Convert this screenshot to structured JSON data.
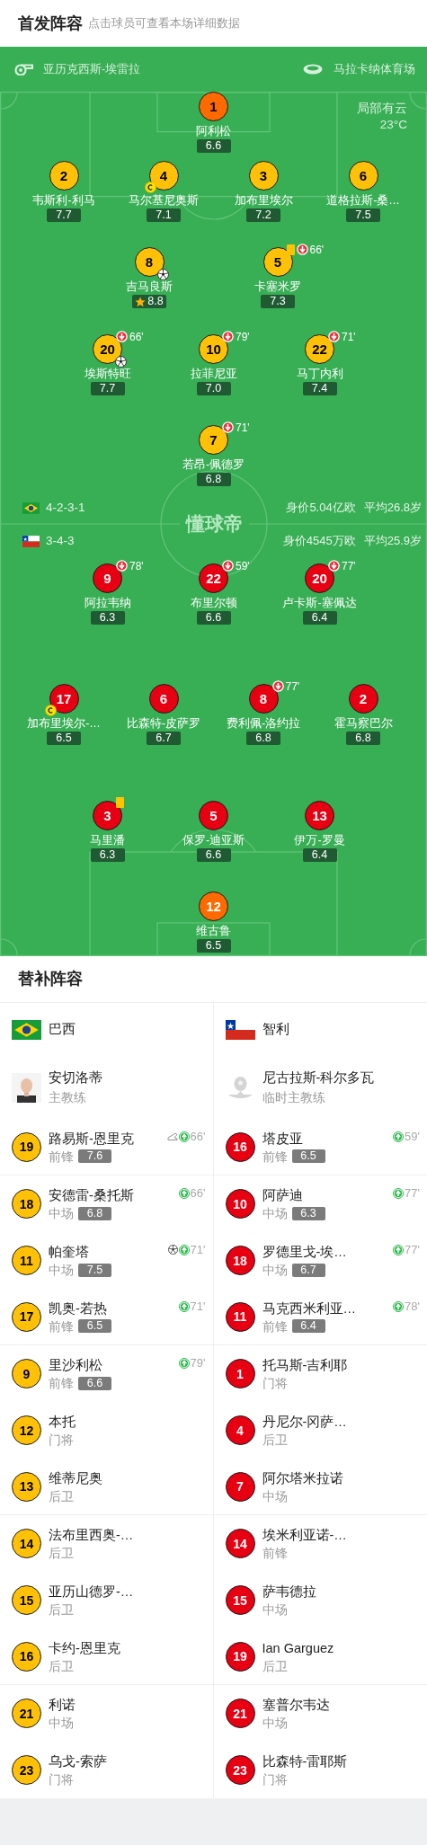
{
  "header": {
    "title": "首发阵容",
    "subtitle": "点击球员可查看本场详细数据"
  },
  "pitch": {
    "referee": "亚历克西斯-埃雷拉",
    "stadium": "马拉卡纳体育场",
    "weather": "局部有云",
    "temperature": "23°C",
    "center_logo": "懂球帝",
    "home": {
      "flag": {
        "kind": "brazil"
      },
      "color": "#ffc107",
      "number_style": {
        "color": "#000000"
      },
      "formation": "4-2-3-1",
      "value": "身价5.04亿欧",
      "avg_age": "平均26.8岁",
      "rows": [
        {
          "kind": "goalkeeper",
          "players": [
            {
              "number": "1",
              "name": "阿利松",
              "rating": "6.6"
            }
          ]
        },
        {
          "kind": "outfield",
          "players": [
            {
              "number": "2",
              "name": "韦斯利-利马",
              "rating": "7.7"
            },
            {
              "number": "4",
              "name": "马尔基尼奥斯",
              "rating": "7.1",
              "marks": [
                {
                  "kind": "captain"
                }
              ]
            },
            {
              "number": "3",
              "name": "加布里埃尔",
              "rating": "7.2"
            },
            {
              "number": "6",
              "name": "道格拉斯-桑…",
              "rating": "7.5"
            }
          ]
        },
        {
          "kind": "outfield",
          "players": [
            {
              "number": "8",
              "name": "吉马良斯",
              "rating": "8.8",
              "marks": [
                {
                  "kind": "goal"
                },
                {
                  "kind": "mvp"
                }
              ]
            },
            {
              "number": "5",
              "name": "卡塞米罗",
              "rating": "7.3",
              "marks": [
                {
                  "kind": "yellow_card"
                }
              ],
              "sub_out": "66'"
            }
          ]
        },
        {
          "kind": "outfield",
          "players": [
            {
              "number": "20",
              "name": "埃斯特旺",
              "rating": "7.7",
              "marks": [
                {
                  "kind": "goal"
                }
              ],
              "sub_out": "66'"
            },
            {
              "number": "10",
              "name": "拉菲尼亚",
              "rating": "7.0",
              "sub_out": "79'"
            },
            {
              "number": "22",
              "name": "马丁内利",
              "rating": "7.4",
              "sub_out": "71'"
            }
          ]
        },
        {
          "kind": "outfield",
          "players": [
            {
              "number": "7",
              "name": "若昂-佩德罗",
              "rating": "6.8",
              "sub_out": "71'"
            }
          ]
        }
      ]
    },
    "away": {
      "flag": {
        "kind": "chile"
      },
      "color": "#e60012",
      "number_style": {
        "color": "#ffffff"
      },
      "formation": "3-4-3",
      "value": "身价4545万欧",
      "avg_age": "平均25.9岁",
      "rows": [
        {
          "kind": "outfield",
          "players": [
            {
              "number": "9",
              "name": "阿拉韦纳",
              "rating": "6.3",
              "sub_out": "78'"
            },
            {
              "number": "22",
              "name": "布里尔顿",
              "rating": "6.6",
              "sub_out": "59'"
            },
            {
              "number": "20",
              "name": "卢卡斯-塞佩达",
              "rating": "6.4",
              "sub_out": "77'"
            }
          ]
        },
        {
          "kind": "outfield",
          "players": [
            {
              "number": "17",
              "name": "加布里埃尔-…",
              "rating": "6.5",
              "marks": [
                {
                  "kind": "captain"
                }
              ]
            },
            {
              "number": "6",
              "name": "比森特-皮萨罗",
              "rating": "6.7"
            },
            {
              "number": "8",
              "name": "费利佩-洛约拉",
              "rating": "6.8",
              "sub_out": "77'"
            },
            {
              "number": "2",
              "name": "霍马察巴尔",
              "rating": "6.8"
            }
          ]
        },
        {
          "kind": "outfield",
          "players": [
            {
              "number": "3",
              "name": "马里潘",
              "rating": "6.3",
              "marks": [
                {
                  "kind": "yellow_card"
                }
              ]
            },
            {
              "number": "5",
              "name": "保罗-迪亚斯",
              "rating": "6.6"
            },
            {
              "number": "13",
              "name": "伊万-罗曼",
              "rating": "6.4"
            }
          ]
        },
        {
          "kind": "goalkeeper",
          "players": [
            {
              "number": "12",
              "name": "维古鲁",
              "rating": "6.5"
            }
          ]
        }
      ]
    }
  },
  "substitutes": {
    "title": "替补阵容",
    "teams": [
      {
        "name": "巴西",
        "flag": {
          "kind": "brazil"
        },
        "color": "#ffc107",
        "number_style": {
          "color": "#000000"
        },
        "coach": {
          "name": "安切洛蒂",
          "role": "主教练"
        },
        "players": [
          {
            "number": "19",
            "name": "路易斯-恩里克",
            "position": "前锋",
            "rating": "7.6",
            "sub_in": "66'",
            "marks": [
              {
                "kind": "assist"
              }
            ]
          },
          {
            "number": "18",
            "name": "安德雷-桑托斯",
            "position": "中场",
            "rating": "6.8",
            "sub_in": "66'"
          },
          {
            "number": "11",
            "name": "帕奎塔",
            "position": "中场",
            "rating": "7.5",
            "sub_in": "71'",
            "marks": [
              {
                "kind": "goal"
              }
            ]
          },
          {
            "number": "17",
            "name": "凯奥-若热",
            "position": "前锋",
            "rating": "6.5",
            "sub_in": "71'"
          },
          {
            "number": "9",
            "name": "里沙利松",
            "position": "前锋",
            "rating": "6.6",
            "sub_in": "79'"
          },
          {
            "number": "12",
            "name": "本托",
            "position": "门将"
          },
          {
            "number": "13",
            "name": "维蒂尼奥",
            "position": "后卫"
          },
          {
            "number": "14",
            "name": "法布里西奥-…",
            "position": "后卫"
          },
          {
            "number": "15",
            "name": "亚历山德罗-…",
            "position": "后卫"
          },
          {
            "number": "16",
            "name": "卡约-恩里克",
            "position": "后卫"
          },
          {
            "number": "21",
            "name": "利诺",
            "position": "中场"
          },
          {
            "number": "23",
            "name": "乌戈-索萨",
            "position": "门将"
          }
        ]
      },
      {
        "name": "智利",
        "flag": {
          "kind": "chile"
        },
        "color": "#e60012",
        "number_style": {
          "color": "#ffffff"
        },
        "coach": {
          "name": "尼古拉斯-科尔多瓦",
          "role": "临时主教练",
          "avatar": {
            "kind": "placeholder"
          }
        },
        "players": [
          {
            "number": "16",
            "name": "塔皮亚",
            "position": "前锋",
            "rating": "6.5",
            "sub_in": "59'"
          },
          {
            "number": "10",
            "name": "阿萨迪",
            "position": "中场",
            "rating": "6.3",
            "sub_in": "77'"
          },
          {
            "number": "18",
            "name": "罗德里戈-埃…",
            "position": "中场",
            "rating": "6.7",
            "sub_in": "77'"
          },
          {
            "number": "11",
            "name": "马克西米利亚…",
            "position": "前锋",
            "rating": "6.4",
            "sub_in": "78'"
          },
          {
            "number": "1",
            "name": "托马斯-吉利耶",
            "position": "门将"
          },
          {
            "number": "4",
            "name": "丹尼尔-冈萨…",
            "position": "后卫"
          },
          {
            "number": "7",
            "name": "阿尔塔米拉诺",
            "position": "中场"
          },
          {
            "number": "14",
            "name": "埃米利亚诺-…",
            "position": "前锋"
          },
          {
            "number": "15",
            "name": "萨韦德拉",
            "position": "中场"
          },
          {
            "number": "19",
            "name": "Ian Garguez",
            "position": "后卫"
          },
          {
            "number": "21",
            "name": "塞普尔韦达",
            "position": "中场"
          },
          {
            "number": "23",
            "name": "比森特-雷耶斯",
            "position": "门将"
          }
        ]
      }
    ]
  }
}
